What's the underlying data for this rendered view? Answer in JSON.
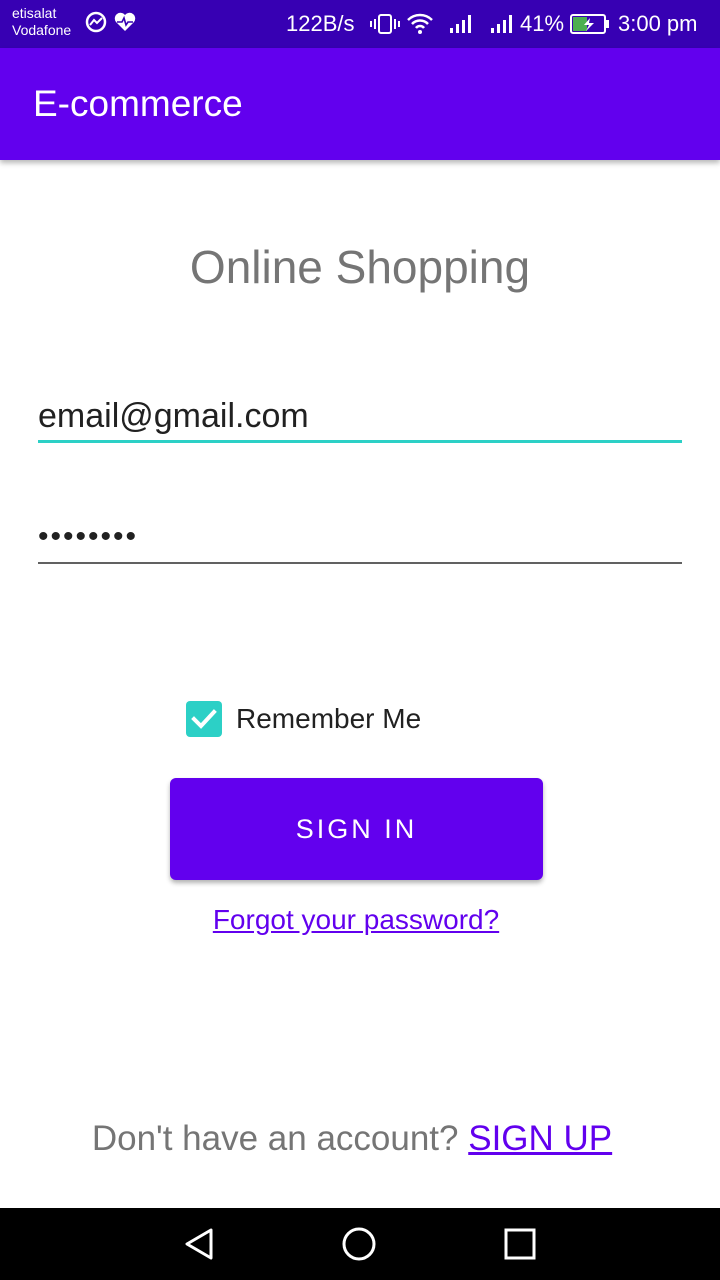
{
  "status_bar": {
    "carrier_1": "etisalat",
    "carrier_2": "Vodafone",
    "data_speed": "122B/s",
    "battery_percent": "41%",
    "time": "3:00 pm",
    "icons": [
      "messenger-icon",
      "health-heart-icon",
      "vibrate-icon",
      "wifi-icon",
      "signal-icon",
      "signal-icon",
      "battery-charging-icon"
    ]
  },
  "app_bar": {
    "title": "E-commerce"
  },
  "login": {
    "heading": "Online Shopping",
    "email_value": "email@gmail.com",
    "password_value": "••••••••",
    "remember_label": "Remember Me",
    "remember_checked": true,
    "signin_label": "SIGN IN",
    "forgot_label": "Forgot your password?",
    "signup_prompt": "Don't have an account?",
    "signup_label": "SIGN UP"
  },
  "nav_bar": {
    "icons": [
      "back-icon",
      "home-icon",
      "recents-icon"
    ]
  },
  "colors": {
    "status_bar": "#3700B3",
    "primary": "#6200EE",
    "accent": "#2CD0C6",
    "muted_text": "#757575"
  }
}
